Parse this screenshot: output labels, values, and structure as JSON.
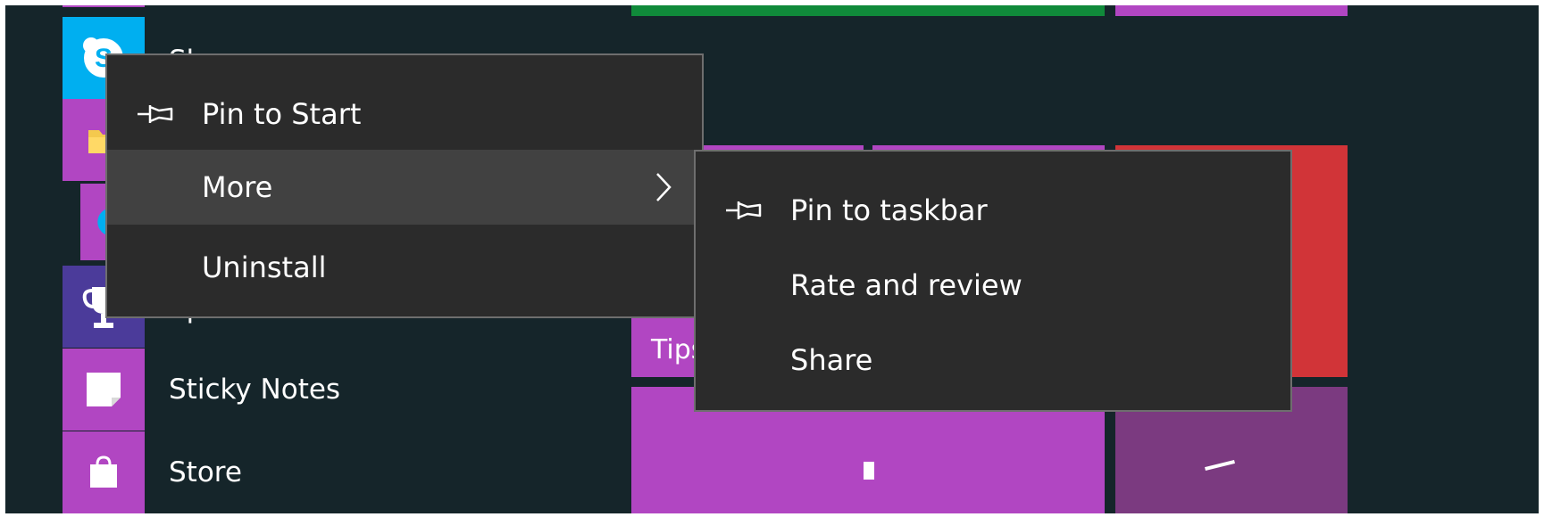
{
  "app_list": {
    "items": [
      {
        "label": "Skype",
        "icon": "skype-icon",
        "color": "#00aff0"
      },
      {
        "label": "",
        "icon": "folder-icon",
        "color": "#b146c2"
      },
      {
        "label": "",
        "icon": "skype-icon",
        "color": "#b146c2"
      },
      {
        "label": "Sports",
        "icon": "trophy-icon",
        "color": "#4b3b9a"
      },
      {
        "label": "Sticky Notes",
        "icon": "sticky-note-icon",
        "color": "#b146c2"
      },
      {
        "label": "Store",
        "icon": "store-bag-icon",
        "color": "#b146c2"
      }
    ]
  },
  "tiles": {
    "tips_label": "Tips"
  },
  "context_menu": {
    "items": [
      {
        "label": "Pin to Start",
        "icon": "pin-icon"
      },
      {
        "label": "More",
        "icon": "chevron-right-icon"
      },
      {
        "label": "Uninstall"
      }
    ]
  },
  "submenu": {
    "items": [
      {
        "label": "Pin to taskbar",
        "icon": "pin-icon"
      },
      {
        "label": "Rate and review"
      },
      {
        "label": "Share"
      }
    ]
  },
  "colors": {
    "background": "#15252a",
    "menu_bg": "#2b2b2b",
    "menu_highlight": "#414141",
    "menu_border": "#6e6e6e",
    "tile_purple": "#b146c2",
    "tile_green": "#108a3a",
    "tile_red": "#d13438",
    "tile_plum": "#7b3a80",
    "skype_blue": "#00aff0"
  }
}
